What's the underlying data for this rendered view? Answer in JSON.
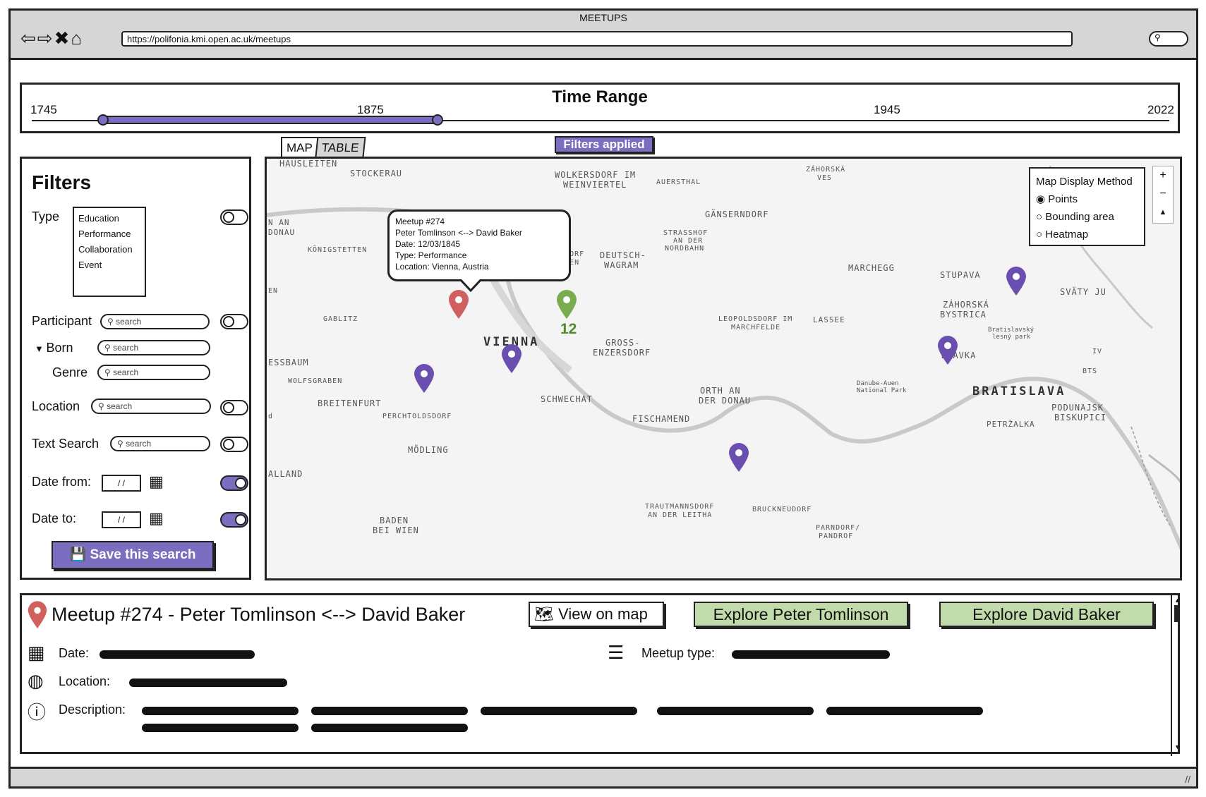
{
  "window": {
    "title": "MEETUPS",
    "url": "https://polifonia.kmi.open.ac.uk/meetups"
  },
  "time_range": {
    "title": "Time Range",
    "ticks": [
      "1745",
      "1875",
      "1945",
      "2022"
    ],
    "selected_range": [
      "1745",
      "1875"
    ]
  },
  "filters": {
    "title": "Filters",
    "type_label": "Type",
    "type_options": [
      "Education",
      "Performance",
      "Collaboration",
      "Event"
    ],
    "participant_label": "Participant",
    "born_label": "Born",
    "genre_label": "Genre",
    "location_label": "Location",
    "text_search_label": "Text Search",
    "search_placeholder": "search",
    "date_from_label": "Date from:",
    "date_to_label": "Date to:",
    "date_placeholder": "/ /",
    "save_label": "Save this search"
  },
  "tabs": {
    "map": "MAP",
    "table": "TABLE",
    "filters_applied": "Filters applied"
  },
  "map": {
    "popup": {
      "line1": "Meetup #274",
      "line2": "Peter Tomlinson <--> David Baker",
      "line3": "Date: 12/03/1845",
      "line4": "Type: Performance",
      "line5": "Location: Vienna, Austria"
    },
    "cluster_count": "12",
    "legend": {
      "title": "Map Display Method",
      "options": [
        "Points",
        "Bounding area",
        "Heatmap"
      ],
      "selected": "Points"
    },
    "zoom": {
      "in": "+",
      "out": "−",
      "north": "▲"
    },
    "places": {
      "vienna": "VIENNA",
      "bratislava": "BRATISLAVA",
      "stockerau": "STOCKERAU",
      "wolkersdorf": "WOLKERSDORF IM",
      "weinviertel": "WEINVIERTEL",
      "auerstahl": "AUERSTHAL",
      "gansern": "GÄNSERNDORF",
      "strasshof": "STRASSHOF",
      "an_der": "AN DER",
      "nordbahn": "NORDBAHN",
      "deutsch": "DEUTSCH-",
      "wagram": "WAGRAM",
      "konig": "KÖNIGSTETTEN",
      "gablitz": "GABLITZ",
      "gross": "GROSS-",
      "enzers": "ENZERSDORF",
      "leopold": "LEOPOLDSDORF IM",
      "marchfelde": "MARCHFELDE",
      "lassee": "LASSEE",
      "marchegg": "MARCHEGG",
      "stupava": "STUPAVA",
      "zahorska": "ZÁHORSKÁ",
      "bystrica": "BYSTRICA",
      "orth": "ORTH AN",
      "der_donau": "DER DONAU",
      "schwechat": "SCHWECHAT",
      "fischamend": "FISCHAMEND",
      "breiten": "BREITENFURT",
      "wolfsgraben": "WOLFSGRABEN",
      "perchtolds": "PERCHTOLDSDORF",
      "modling": "MÖDLING",
      "baden": "BADEN",
      "bei_wien": "BEI WIEN",
      "trautmann": "TRAUTMANNSDORF",
      "an_der_leitha": "AN DER LEITHA",
      "bruck": "BRUCKNEUDORF",
      "parndorf": "PARNDORF/",
      "pandrof": "PANDROF",
      "petrzalka": "PETRŽALKA",
      "podunaj": "PODUNAJSK",
      "biskupici": "BISKUPICI",
      "svaty": "SVÄTY JU",
      "hausleiten": "HAUSLEITEN",
      "danube_auen": "Danube-Auen",
      "national_park": "National Park",
      "bratislavsky": "Bratislavský",
      "lesny_park": "lesný park",
      "zahorska_ves": "ZÁHORSKÁ",
      "ves": "VES",
      "essbaum": "ESSBAUM",
      "alland": "ALLAND",
      "n_an": "N AN",
      "donau_left": "DONAU",
      "erasdorf": "ERASDORF",
      "ei_wien": "EI-WIEN",
      "devinska": "D   AVKA",
      "bts": "BTS",
      "iv": "IV",
      "en": "EN",
      "d": "d"
    }
  },
  "details": {
    "title": "Meetup #274 - Peter Tomlinson <--> David Baker",
    "view_on_map": "View on map",
    "explore1": "Explore Peter Tomlinson",
    "explore2": "Explore David Baker",
    "date_label": "Date:",
    "meetup_type_label": "Meetup type:",
    "location_label": "Location:",
    "description_label": "Description:"
  },
  "colors": {
    "accent": "#7b6dc0",
    "green_button": "#c2dbab",
    "pin_red": "#d0605e",
    "pin_purple": "#6a4fb0",
    "pin_green": "#79ac4e"
  }
}
